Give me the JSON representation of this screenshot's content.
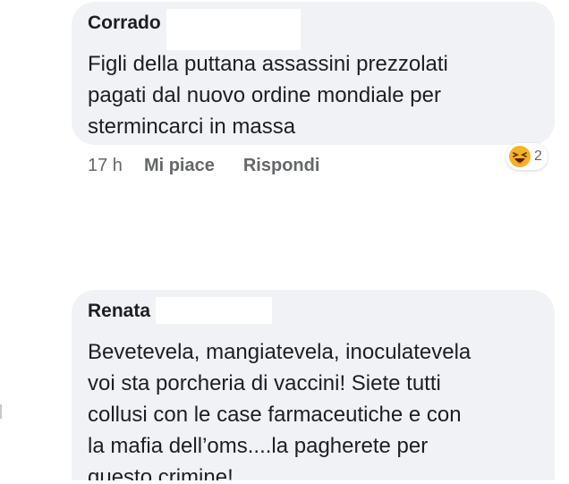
{
  "comments": [
    {
      "author": "Corrado",
      "lines": [
        "Figli della puttana assassini prezzolati",
        "pagati dal nuovo ordine mondiale per",
        "stermincarci in massa"
      ],
      "time": "17 h",
      "like_label": "Mi piace",
      "reply_label": "Rispondi",
      "reaction_icon": "haha-emoji-icon",
      "reaction_count": "2"
    },
    {
      "author": "Renata",
      "lines": [
        "Bevetevela, mangiatevela, inoculatevela",
        "voi sta porcheria di vaccini! Siete tutti",
        "collusi con le case farmaceutiche e con",
        "la mafia dell’oms....la pagherete per",
        "questo crimine!"
      ]
    }
  ],
  "colors": {
    "bubble_background": "#f0f2f5",
    "text": "#1c1e21",
    "secondary_text": "#65676b",
    "emoji": "#f7b125"
  }
}
